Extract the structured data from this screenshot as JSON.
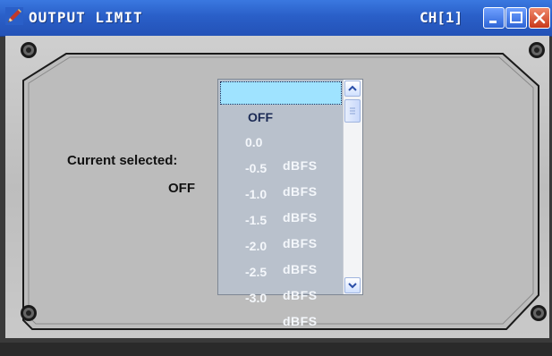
{
  "window": {
    "title": "OUTPUT LIMIT",
    "channel": "CH[1]"
  },
  "panel": {
    "current_label": "Current selected:",
    "current_value": "OFF"
  },
  "list": {
    "items": [
      {
        "value": "OFF",
        "unit": ""
      },
      {
        "value": "0.0",
        "unit": "dBFS"
      },
      {
        "value": "-0.5",
        "unit": "dBFS"
      },
      {
        "value": "-1.0",
        "unit": "dBFS"
      },
      {
        "value": "-1.5",
        "unit": "dBFS"
      },
      {
        "value": "-2.0",
        "unit": "dBFS"
      },
      {
        "value": "-2.5",
        "unit": "dBFS"
      },
      {
        "value": "-3.0",
        "unit": "dBFS"
      }
    ],
    "selected_index": 0
  },
  "icons": {
    "app": "pencil-icon",
    "minimize": "minimize-icon",
    "maximize": "maximize-icon",
    "close": "close-icon",
    "scroll_up": "chevron-up-icon",
    "scroll_down": "chevron-down-icon"
  },
  "colors": {
    "titlebar": "#2a5fc8",
    "selection": "#9fe3ff",
    "list_bg": "#b9c1cc",
    "close_button": "#c8381a"
  }
}
